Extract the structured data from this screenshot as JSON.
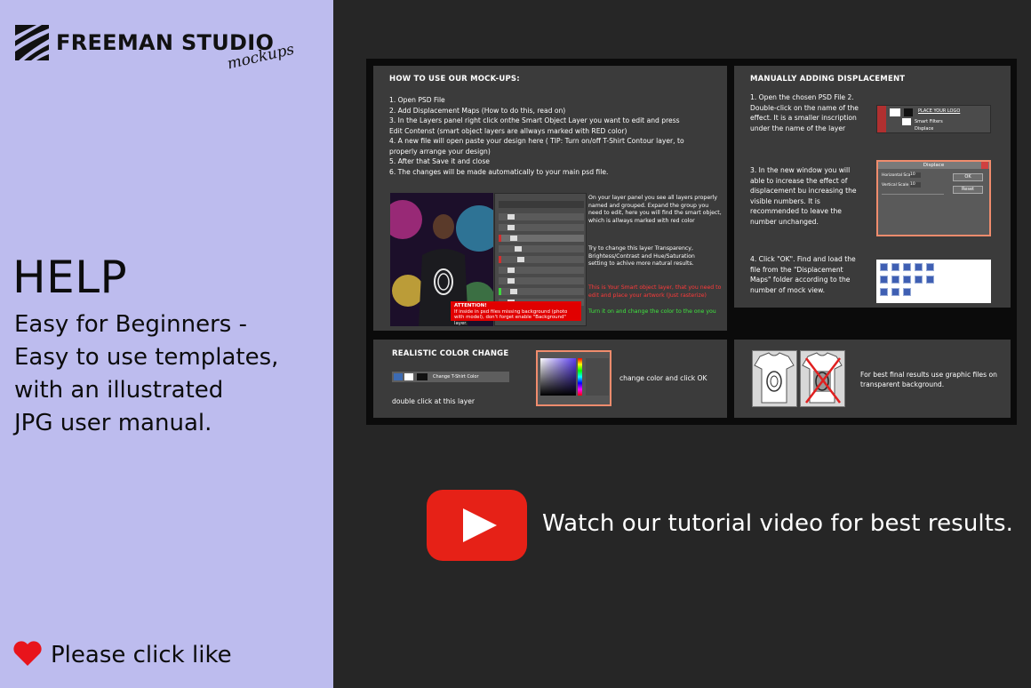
{
  "brand": {
    "name": "FREEMAN STUDIO",
    "script": "mockups"
  },
  "help": {
    "title": "HELP",
    "lines": [
      "Easy for Beginners -",
      "Easy to use templates,",
      "with an illustrated",
      "JPG user manual."
    ]
  },
  "like": {
    "label": "Please click like"
  },
  "video": {
    "label": "Watch our tutorial video for best results."
  },
  "panels": {
    "howto": {
      "title": "HOW TO USE OUR MOCK-UPS:",
      "steps": [
        "1.  Open PSD File",
        "2.  Add Displacement Maps (How to do this, read on)",
        "3.  In the Layers panel right click onthe Smart Object Layer you want to edit and press",
        "Edit Contenst (smart object layers are allways marked with RED color)",
        "4.  A new file will open paste your design here ( TIP: Turn on/off T-Shirt Contour layer, to",
        "properly arrange your design)",
        "5.  After that Save it and close",
        "6.  The changes will be made automatically to your main psd file."
      ],
      "side_note_1": "On your layer panel you see all layers properly named and grouped. Expand the group you need to edit, here you will find the smart object, which is allways marked with red color",
      "side_note_2": "Try to change this layer Transparency, Brightess/Contrast and Hue/Saturation setting to achive more natural results.",
      "side_note_red": "This is Your Smart object layer, that you need to edit and place your artwork (Just rasterize)",
      "side_note_green": "Turn it on and change the color to the one you",
      "attention_title": "ATTENTION!",
      "attention_body": "If inside in psd files missing background (photo with model), don't forget enable \"Background\" layer."
    },
    "displacement": {
      "title": "MANUALLY ADDING DISPLACEMENT",
      "step1": "1. Open the chosen PSD File 2. Double-click on the name of the effect. It is a smaller inscription under the name of the layer",
      "step3": "3. In the new window you will able to increase the effect of displacement bu increasing the visible numbers. It is recommended to leave the number unchanged.",
      "step4": "4. Click \"OK\". Find and load the file from the \"Displacement Maps\" folder according to the number of mock view.",
      "ps_layer_label": "PLACE YOUR LOGO",
      "ps_filter_label": "Smart Filters",
      "ps_effect_label": "Displace",
      "dialog_title": "Displace",
      "dialog_ok": "OK",
      "dialog_reset": "Reset",
      "dialog_h": "Horizontal Scale",
      "dialog_v": "Vertical Scale",
      "dialog_h_val": "10",
      "dialog_v_val": "10"
    },
    "color": {
      "title": "REALISTIC  COLOR CHANGE",
      "layer_label": "Change T-Shirt Color",
      "hint": "double click at this layer",
      "action": "change color and click OK"
    },
    "transparent": {
      "note": "For best final results use graphic files on transparent background."
    }
  },
  "colors": {
    "left_bg": "#bdbcee",
    "page_bg": "#262626",
    "panel_bg": "#3b3b3b",
    "accent_red": "#e62117",
    "dialog_border": "#f08c6d"
  }
}
